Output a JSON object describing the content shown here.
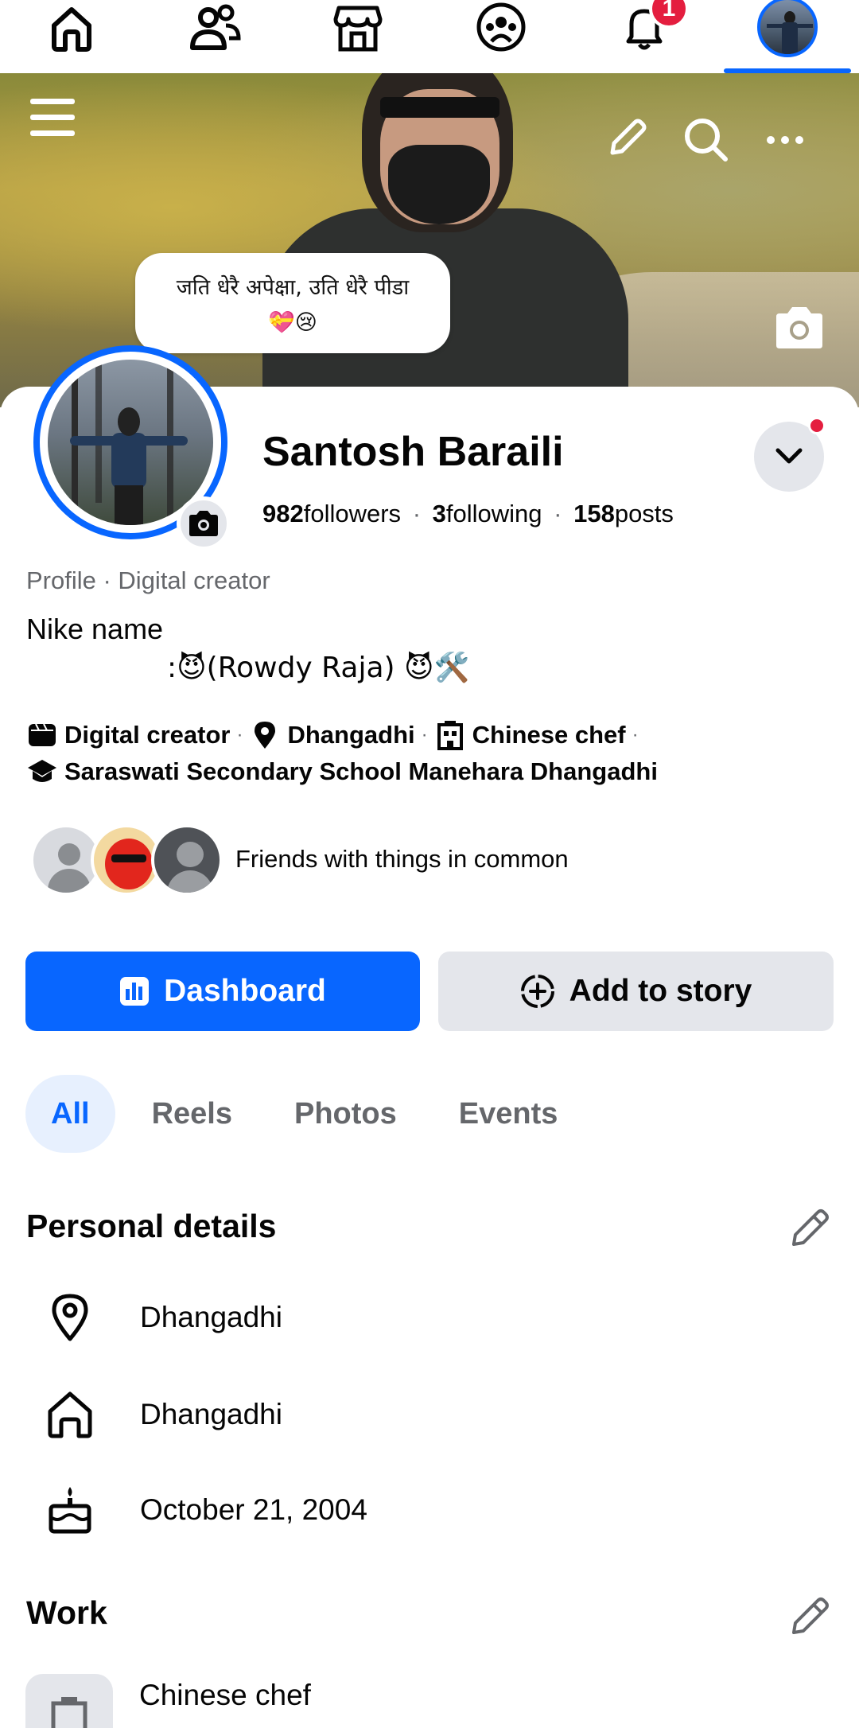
{
  "nav": {
    "tabs": [
      {
        "name": "home",
        "icon": "home-icon"
      },
      {
        "name": "friends",
        "icon": "friends-icon"
      },
      {
        "name": "marketplace",
        "icon": "marketplace-icon"
      },
      {
        "name": "groups",
        "icon": "groups-icon"
      },
      {
        "name": "notifications",
        "icon": "bell-icon",
        "badge": "1"
      },
      {
        "name": "profile",
        "icon": "profile-avatar",
        "active": true
      }
    ],
    "notification_badge": "1"
  },
  "cover": {
    "note_line1": "जति धेरै अपेक्षा, उति धेरै पीडा",
    "note_line2": "💝😢"
  },
  "profile": {
    "name": "Santosh Baraili",
    "followers_count": "982",
    "followers_label": "followers",
    "following_count": "3",
    "following_label": "following",
    "posts_count": "158",
    "posts_label": "posts",
    "separator": "·",
    "category": "Profile · Digital creator",
    "bio_line1": "Nike name",
    "bio_line2": ":😈(Rowdy Raja) 😈🛠️",
    "details": {
      "creator": "Digital creator",
      "location": "Dhangadhi",
      "job": "Chinese chef",
      "school": "Saraswati Secondary School Manehara Dhangadhi"
    },
    "mutuals_text": "Friends with things in common"
  },
  "actions": {
    "dashboard_label": "Dashboard",
    "add_story_label": "Add to story"
  },
  "tabs": [
    "All",
    "Reels",
    "Photos",
    "Events"
  ],
  "personal_details": {
    "title": "Personal details",
    "current_city": "Dhangadhi",
    "hometown": "Dhangadhi",
    "birthday": "October 21, 2004"
  },
  "work": {
    "title": "Work",
    "job": "Chinese chef"
  },
  "colors": {
    "accent": "#0866ff",
    "badge": "#e41e3f",
    "secondary_button": "#e4e6eb",
    "muted_text": "#65676b"
  }
}
